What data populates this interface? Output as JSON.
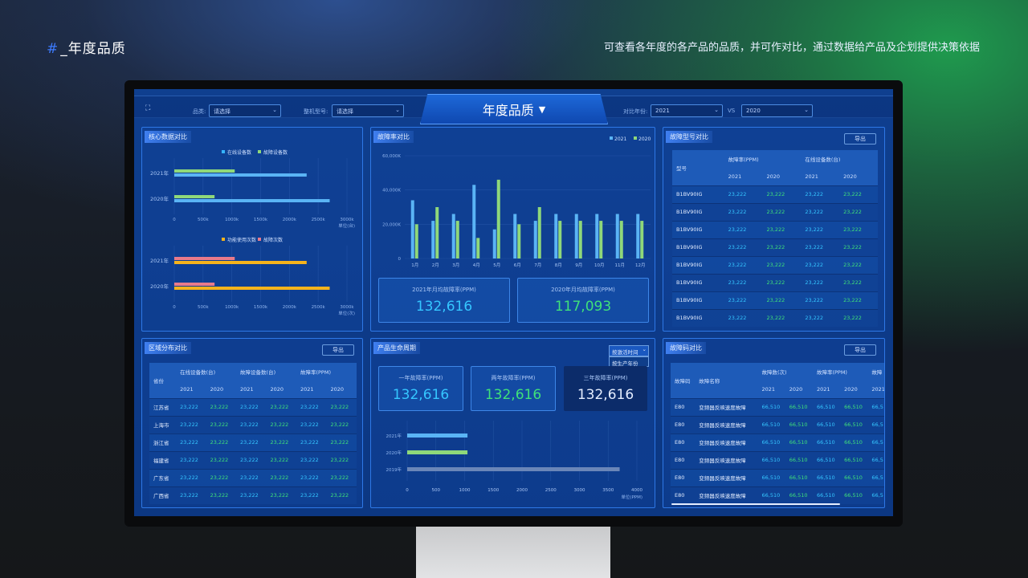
{
  "header": {
    "hash": "#",
    "title": "_年度品质",
    "subtitle": "可查看各年度的各产品的品质，并可作对比，通过数据给产品及企划提供决策依据"
  },
  "topbar": {
    "category_label": "品类:",
    "category_placeholder": "请选择",
    "model_label": "整机型号:",
    "model_placeholder": "请选择",
    "title": "年度品质",
    "title_caret": "▼",
    "compare_label": "对比年份:",
    "year_a": "2021",
    "vs": "VS",
    "year_b": "2020"
  },
  "core": {
    "title": "核心数据对比",
    "chart1": {
      "legend": [
        "在线设备数",
        "故障设备数"
      ],
      "categories": [
        "2021年",
        "2020年"
      ],
      "series": [
        {
          "name": "在线设备数",
          "values": [
            2300,
            2700
          ]
        },
        {
          "name": "故障设备数",
          "values": [
            1050,
            700
          ]
        }
      ],
      "ticks": [
        "0",
        "500k",
        "1000k",
        "1500k",
        "2000k",
        "2500k",
        "3000k"
      ],
      "unit": "单位(台)"
    },
    "chart2": {
      "legend": [
        "功能使用次数",
        "故障次数"
      ],
      "categories": [
        "2021年",
        "2020年"
      ],
      "series": [
        {
          "name": "功能使用次数",
          "values": [
            2300,
            2700
          ]
        },
        {
          "name": "故障次数",
          "values": [
            1050,
            700
          ]
        }
      ],
      "ticks": [
        "0",
        "500k",
        "1000k",
        "1500k",
        "2000k",
        "2500k",
        "3000k"
      ],
      "unit": "单位(次)"
    }
  },
  "fault_rate": {
    "title": "故障率对比",
    "legend": [
      "2021",
      "2020"
    ],
    "yticks": [
      "0",
      "20,000K",
      "40,000K",
      "60,000K"
    ],
    "months": [
      "1月",
      "2月",
      "3月",
      "4月",
      "5月",
      "6月",
      "7月",
      "8月",
      "9月",
      "10月",
      "11月",
      "12月"
    ],
    "v2021": [
      34,
      22,
      26,
      43,
      17,
      26,
      22,
      26,
      26,
      26,
      26,
      26
    ],
    "v2020": [
      20,
      30,
      22,
      12,
      46,
      20,
      30,
      22,
      22,
      22,
      22,
      22
    ],
    "kpi1_label": "2021年月均故障率(PPM)",
    "kpi1_value": "132,616",
    "kpi2_label": "2020年月均故障率(PPM)",
    "kpi2_value": "117,093"
  },
  "model_table": {
    "title": "故障型号对比",
    "export": "导出",
    "h_model": "型号",
    "h_rate": "故障率(PPM)",
    "h_online": "在线设备数(台)",
    "years": [
      "2021",
      "2020",
      "2021",
      "2020"
    ],
    "rows": [
      [
        "B1BV90IG",
        "23,222",
        "23,222",
        "23,222",
        "23,222"
      ],
      [
        "B1BV90IG",
        "23,222",
        "23,222",
        "23,222",
        "23,222"
      ],
      [
        "B1BV90IG",
        "23,222",
        "23,222",
        "23,222",
        "23,222"
      ],
      [
        "B1BV90IG",
        "23,222",
        "23,222",
        "23,222",
        "23,222"
      ],
      [
        "B1BV90IG",
        "23,222",
        "23,222",
        "23,222",
        "23,222"
      ],
      [
        "B1BV90IG",
        "23,222",
        "23,222",
        "23,222",
        "23,222"
      ],
      [
        "B1BV90IG",
        "23,222",
        "23,222",
        "23,222",
        "23,222"
      ],
      [
        "B1BV90IG",
        "23,222",
        "23,222",
        "23,222",
        "23,222"
      ]
    ]
  },
  "region": {
    "title": "区域分布对比",
    "export": "导出",
    "h_province": "省份",
    "h_online": "在线设备数(台)",
    "h_fault": "故障设备数(台)",
    "h_rate": "故障率(PPM)",
    "years": [
      "2021",
      "2020",
      "2021",
      "2020",
      "2021",
      "2020"
    ],
    "rows": [
      [
        "江苏省",
        "23,222",
        "23,222",
        "23,222",
        "23,222",
        "23,222",
        "23,222"
      ],
      [
        "上海市",
        "23,222",
        "23,222",
        "23,222",
        "23,222",
        "23,222",
        "23,222"
      ],
      [
        "浙江省",
        "23,222",
        "23,222",
        "23,222",
        "23,222",
        "23,222",
        "23,222"
      ],
      [
        "福建省",
        "23,222",
        "23,222",
        "23,222",
        "23,222",
        "23,222",
        "23,222"
      ],
      [
        "广东省",
        "23,222",
        "23,222",
        "23,222",
        "23,222",
        "23,222",
        "23,222"
      ],
      [
        "广西省",
        "23,222",
        "23,222",
        "23,222",
        "23,222",
        "23,222",
        "23,222"
      ]
    ]
  },
  "lifecycle": {
    "title": "产品生命周期",
    "dropdown": "按激活时间",
    "dropdown_option": "按生产年份",
    "k1_label": "一年故障率(PPM)",
    "k1_value": "132,616",
    "k2_label": "两年故障率(PPM)",
    "k2_value": "132,616",
    "k3_label": "三年故障率(PPM)",
    "k3_value": "132,616",
    "categories": [
      "2021年",
      "2020年",
      "2019年"
    ],
    "values": [
      1050,
      1050,
      3700
    ],
    "ticks": [
      "0",
      "500",
      "1000",
      "1500",
      "2000",
      "2500",
      "3000",
      "3500",
      "4000"
    ],
    "unit": "单位(PPM)"
  },
  "code_table": {
    "title": "故障码对比",
    "export": "导出",
    "h_code": "故障码",
    "h_name": "故障名称",
    "h_count": "故障数(次)",
    "h_rate": "故障率(PPM)",
    "h_extra": "故障",
    "years": [
      "2021",
      "2020",
      "2021",
      "2020",
      "2021"
    ],
    "rows": [
      [
        "E80",
        "变频器反映速度故障",
        "66,510",
        "66,510",
        "66,510",
        "66,510",
        "66,5"
      ],
      [
        "E80",
        "变频器反映速度故障",
        "66,510",
        "66,510",
        "66,510",
        "66,510",
        "66,5"
      ],
      [
        "E80",
        "变频器反映速度故障",
        "66,510",
        "66,510",
        "66,510",
        "66,510",
        "66,5"
      ],
      [
        "E80",
        "变频器反映速度故障",
        "66,510",
        "66,510",
        "66,510",
        "66,510",
        "66,5"
      ],
      [
        "E80",
        "变频器反映速度故障",
        "66,510",
        "66,510",
        "66,510",
        "66,510",
        "66,5"
      ],
      [
        "E80",
        "变频器反映速度故障",
        "66,510",
        "66,510",
        "66,510",
        "66,510",
        "66,5"
      ]
    ]
  },
  "colors": {
    "blue": "#5ab4f5",
    "green": "#8fd87a",
    "pink": "#e87a8a",
    "orange": "#f5b31c"
  }
}
